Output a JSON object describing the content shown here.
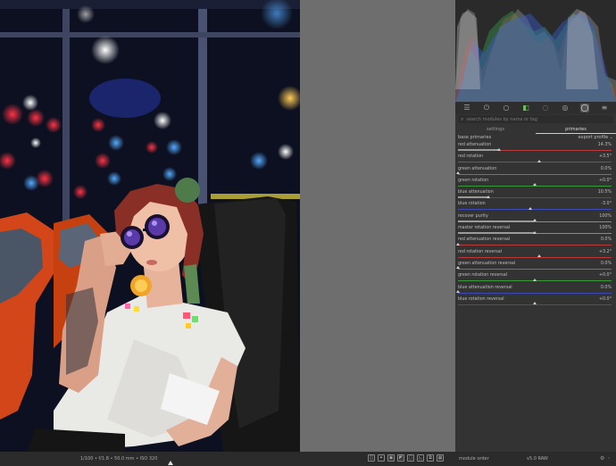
{
  "panel": {
    "tabs": [
      {
        "icon": "sliders-icon"
      },
      {
        "icon": "power-icon"
      },
      {
        "icon": "circle-icon"
      },
      {
        "icon": "color-icon"
      },
      {
        "icon": "droplet-icon"
      },
      {
        "icon": "aperture-icon"
      },
      {
        "icon": "active-module-icon"
      },
      {
        "icon": "menu-icon"
      }
    ],
    "search_placeholder": "search modules by name or tag",
    "subtabs": [
      "settings",
      "primaries"
    ],
    "base_label": "base primaries",
    "base_value": "export profile",
    "sliders": [
      {
        "label": "red attenuation",
        "value": "14.3%",
        "level": 0.27,
        "color": "#b83a3a",
        "type": "fill"
      },
      {
        "label": "red rotation",
        "value": "+3.5°",
        "level": 0.53,
        "color": "#b83a3a",
        "type": "center"
      },
      {
        "label": "green attenuation",
        "value": "0.0%",
        "level": 0.0,
        "color": "#3a9a3a",
        "type": "fill"
      },
      {
        "label": "green rotation",
        "value": "+0.0°",
        "level": 0.5,
        "color": "#3a9a3a",
        "type": "center"
      },
      {
        "label": "blue attenuation",
        "value": "10.5%",
        "level": 0.2,
        "color": "#3a4ab8",
        "type": "fill"
      },
      {
        "label": "blue rotation",
        "value": "-3.0°",
        "level": 0.47,
        "color": "#3a4ab8",
        "type": "center"
      },
      {
        "label": "recover purity",
        "value": "100%",
        "level": 0.5,
        "color": "#8a8a8a",
        "type": "fill"
      },
      {
        "label": "master rotation reversal",
        "value": "100%",
        "level": 0.5,
        "color": "#8a8a8a",
        "type": "fill"
      },
      {
        "label": "red attenuation reversal",
        "value": "0.0%",
        "level": 0.0,
        "color": "#b83a3a",
        "type": "fill"
      },
      {
        "label": "red rotation reversal",
        "value": "+3.2°",
        "level": 0.53,
        "color": "#b83a3a",
        "type": "center"
      },
      {
        "label": "green attenuation reversal",
        "value": "0.0%",
        "level": 0.0,
        "color": "#3a9a3a",
        "type": "fill"
      },
      {
        "label": "green rotation reversal",
        "value": "+0.0°",
        "level": 0.5,
        "color": "#3a9a3a",
        "type": "center"
      },
      {
        "label": "blue attenuation reversal",
        "value": "0.0%",
        "level": 0.0,
        "color": "#3a4ab8",
        "type": "fill"
      },
      {
        "label": "blue rotation reversal",
        "value": "+0.0°",
        "level": 0.5,
        "color": "#3a4ab8",
        "type": "center"
      }
    ]
  },
  "bottom": {
    "exif": "1/100 • f/1.8 • 50.0 mm • ISO 320",
    "module_order_label": "module order",
    "module_order_value": "v5.0 RAW",
    "icons": [
      "focus-peaking-icon",
      "bulb-icon",
      "clipping-icon",
      "gamut-icon",
      "softproof-icon",
      "guides-icon",
      "second-window-icon",
      "grid-icon"
    ]
  }
}
